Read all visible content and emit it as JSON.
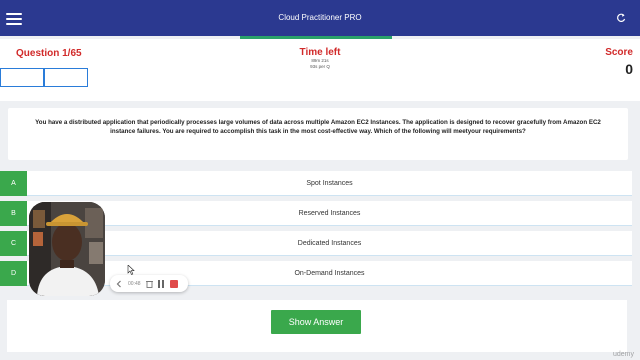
{
  "topbar": {
    "title": "Cloud Practitioner PRO",
    "menu_icon": "hamburger-menu-icon",
    "refresh_icon": "refresh-icon",
    "color": "#2b3990"
  },
  "header": {
    "question_label": "Question 1/65",
    "time_label": "Time left",
    "time_remaining": "89m 21s",
    "time_per_question": "93s per Q",
    "score_label": "Score",
    "score_value": "0"
  },
  "question": {
    "text": "You have a distributed application that periodically processes large volumes of data across multiple Amazon EC2 Instances. The application is designed to recover gracefully from Amazon EC2 instance failures. You are required to accomplish this task in the most cost-effective way. Which of the following will meetyour requirements?"
  },
  "options": [
    {
      "letter": "A",
      "text": "Spot Instances"
    },
    {
      "letter": "B",
      "text": "Reserved Instances"
    },
    {
      "letter": "C",
      "text": "Dedicated Instances"
    },
    {
      "letter": "D",
      "text": "On-Demand Instances"
    }
  ],
  "show_answer_label": "Show Answer",
  "recorder": {
    "elapsed": "00:48"
  },
  "watermark": "udemy",
  "colors": {
    "accent_red": "#d12a2a",
    "option_green": "#3aa84c",
    "progress_green": "#2aa26a"
  }
}
